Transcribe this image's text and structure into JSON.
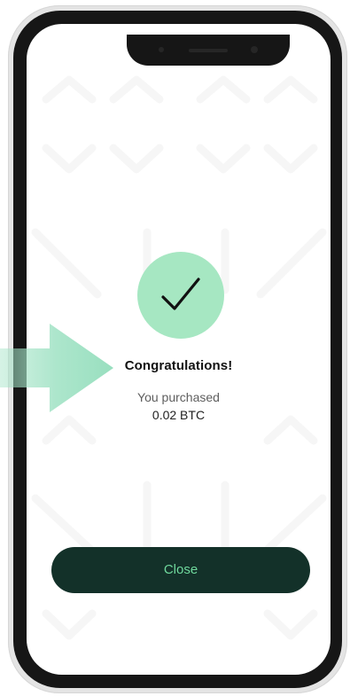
{
  "success": {
    "title": "Congratulations!",
    "message": "You purchased",
    "amount": "0.02 BTC",
    "icon": "checkmark-icon",
    "badge_color": "#a6e7c2"
  },
  "actions": {
    "close_label": "Close",
    "close_bg": "#133129",
    "close_text_color": "#6fd89c"
  },
  "annotation": {
    "icon": "arrow-right-icon",
    "color": "#a3e3c6"
  }
}
